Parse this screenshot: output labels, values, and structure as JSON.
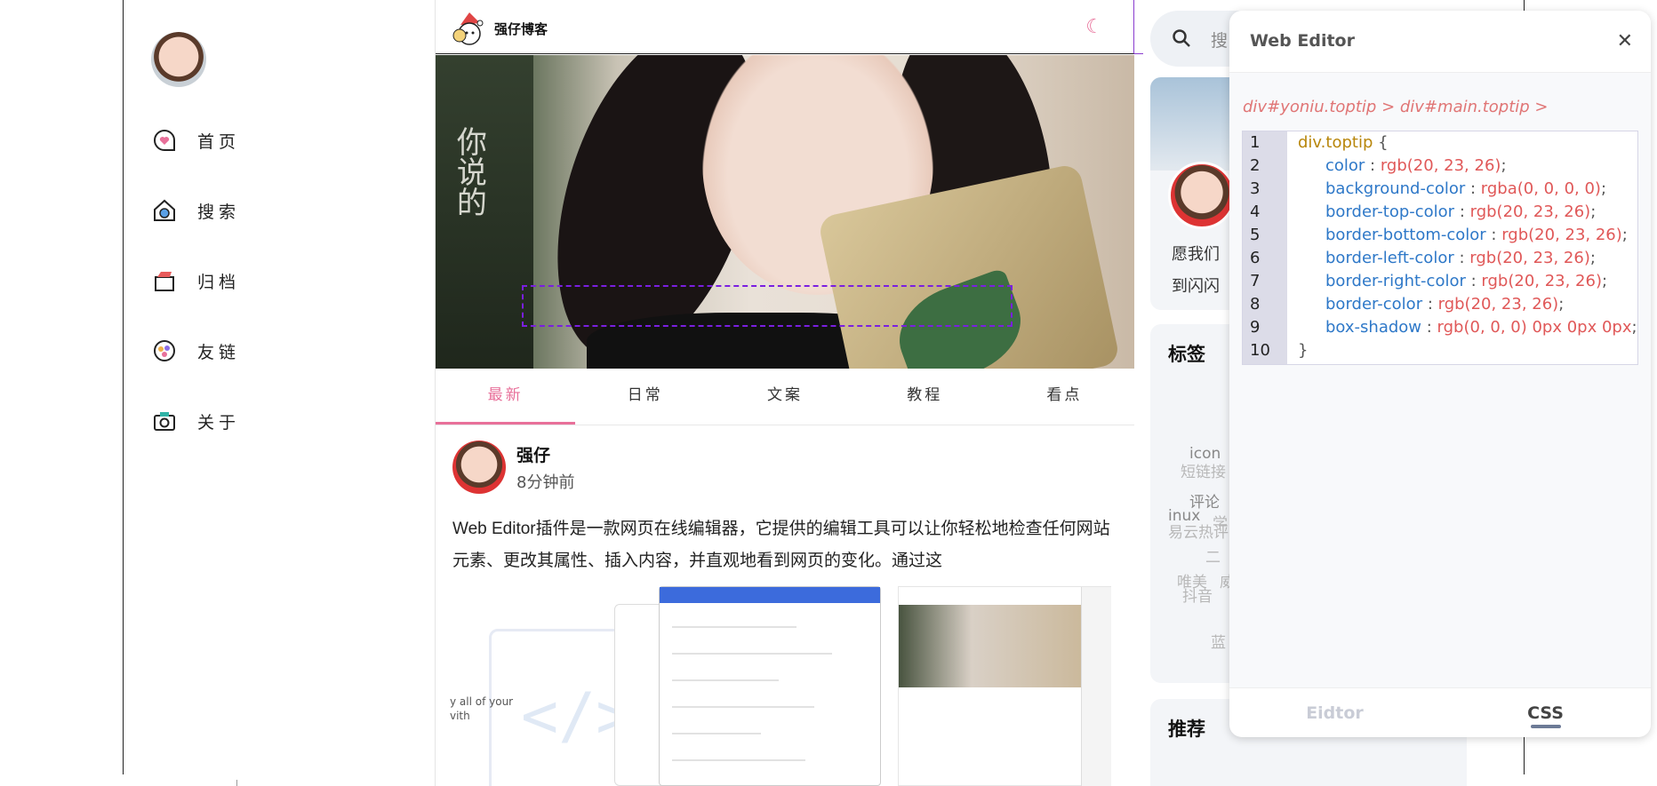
{
  "nav": {
    "items": [
      {
        "label": "首页",
        "icon": "heart-chat-icon"
      },
      {
        "label": "搜索",
        "icon": "search-home-icon"
      },
      {
        "label": "归档",
        "icon": "archive-box-icon"
      },
      {
        "label": "友链",
        "icon": "friend-link-icon"
      },
      {
        "label": "关于",
        "icon": "camera-icon"
      }
    ]
  },
  "header": {
    "logo_text": "强仔博客",
    "theme_icon": "moon-icon"
  },
  "hero": {
    "sign_text": "你说的"
  },
  "tabs": [
    "最新",
    "日常",
    "文案",
    "教程",
    "看点"
  ],
  "post": {
    "author": "强仔",
    "time": "8分钟前",
    "body": "Web Editor插件是一款网页在线编辑器，它提供的编辑工具可以让你轻松地检查任何网站元素、更改其属性、插入内容，并直观地看到网页的变化。通过这",
    "thumb_text": "y all of your\nvith"
  },
  "sidebar": {
    "search_placeholder": "搜",
    "motto_line1": "愿我们",
    "motto_line2": "到闪闪",
    "tags_title": "标签",
    "tags": [
      "icon",
      "短链接",
      "评论",
      "inux",
      "学",
      "易云热评",
      "二",
      "唯美",
      "威",
      "抖音",
      "蓝"
    ],
    "recommend_title": "推荐"
  },
  "editor": {
    "title": "Web Editor",
    "close_icon": "close-icon",
    "breadcrumb": "div#yoniu.toptip > div#main.toptip >",
    "line_numbers": [
      "1",
      "2",
      "3",
      "4",
      "5",
      "6",
      "7",
      "8",
      "9",
      "10"
    ],
    "selector": "div.toptip",
    "open_brace": "{",
    "close_brace": "}",
    "rules": [
      {
        "prop": "color",
        "value": "rgb(20, 23, 26)"
      },
      {
        "prop": "background-color",
        "value": "rgba(0, 0, 0, 0)"
      },
      {
        "prop": "border-top-color",
        "value": "rgb(20, 23, 26)"
      },
      {
        "prop": "border-bottom-color",
        "value": "rgb(20, 23, 26)"
      },
      {
        "prop": "border-left-color",
        "value": "rgb(20, 23, 26)"
      },
      {
        "prop": "border-right-color",
        "value": "rgb(20, 23, 26)"
      },
      {
        "prop": "border-color",
        "value": "rgb(20, 23, 26)"
      },
      {
        "prop": "box-shadow",
        "value": "rgb(0, 0, 0) 0px 0px 0px"
      }
    ],
    "tabs": [
      {
        "label": "Eidtor",
        "active": false
      },
      {
        "label": "CSS",
        "active": true
      }
    ]
  },
  "colors": {
    "accent": "#e8709a",
    "selection": "#7a1fe0",
    "css_prop": "#2e78c8",
    "css_value": "#e05858",
    "css_selector": "#b8860b"
  }
}
